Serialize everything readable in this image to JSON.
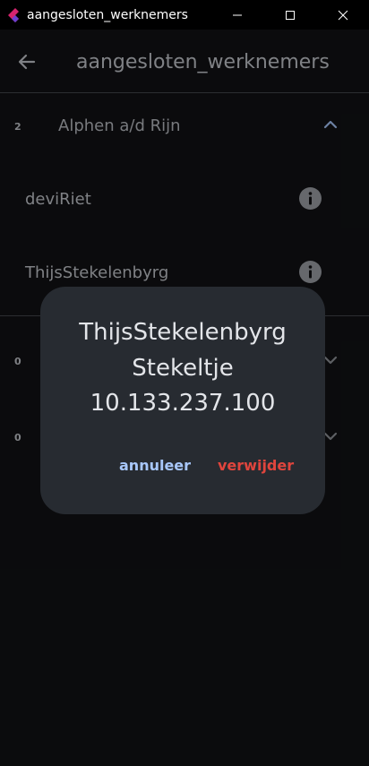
{
  "window": {
    "title": "aangesloten_werknemers"
  },
  "appbar": {
    "title": "aangesloten_werknemers"
  },
  "groups": [
    {
      "count": "2",
      "name": "Alphen a/d Rijn",
      "expanded": true,
      "employees": [
        {
          "name": "deviRiet"
        },
        {
          "name": "ThijsStekelenbyrg"
        }
      ]
    },
    {
      "count": "0",
      "name": "",
      "expanded": false
    },
    {
      "count": "0",
      "name": "",
      "expanded": false
    }
  ],
  "dialog": {
    "line1": "ThijsStekelenbyrg",
    "line2": "Stekeltje",
    "line3": "10.133.237.100",
    "cancel_label": "annuleer",
    "delete_label": "verwijder"
  },
  "colors": {
    "accent": "#a8c7fa",
    "danger": "#e0453d",
    "dialog_bg": "#272b31",
    "background": "#111214"
  },
  "icons": [
    "app-logo-icon",
    "minimize-icon",
    "maximize-icon",
    "close-icon",
    "back-arrow-icon",
    "chevron-up-icon",
    "chevron-down-icon",
    "info-icon"
  ]
}
